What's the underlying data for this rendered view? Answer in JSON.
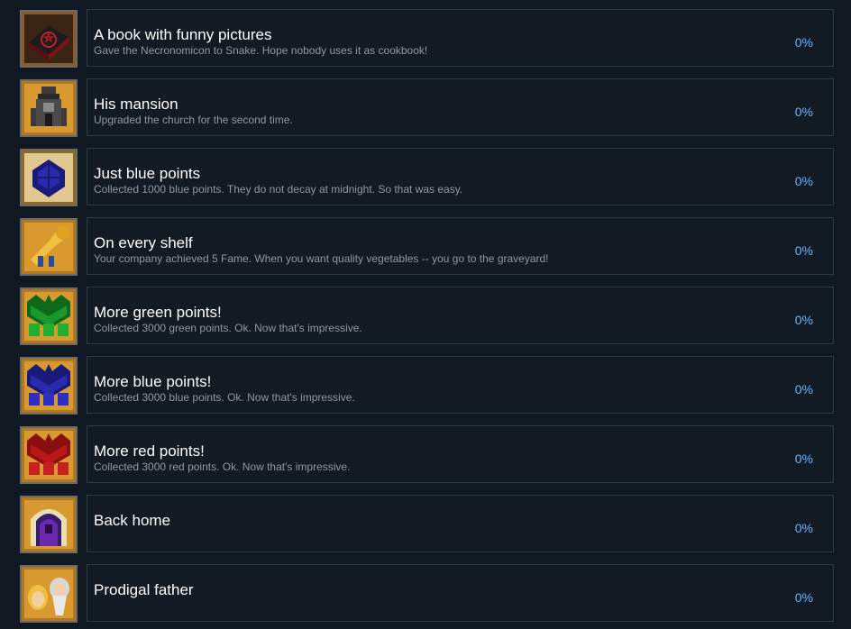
{
  "achievements": [
    {
      "title": "A book with funny pictures",
      "description": "Gave the Necronomicon to Snake. Hope nobody uses it as cookbook!",
      "percent": "0%",
      "icon": "necronomicon-book-icon"
    },
    {
      "title": "His mansion",
      "description": "Upgraded the church for the second time.",
      "percent": "0%",
      "icon": "church-mansion-icon"
    },
    {
      "title": "Just blue points",
      "description": "Collected 1000 blue points. They do not decay at midnight. So that was easy.",
      "percent": "0%",
      "icon": "blue-points-icon"
    },
    {
      "title": "On every shelf",
      "description": "Your company achieved 5 Fame. When you want quality vegetables -- you go to the graveyard!",
      "percent": "0%",
      "icon": "fame-trumpet-icon"
    },
    {
      "title": "More green points!",
      "description": "Collected 3000 green points. Ok. Now that's impressive.",
      "percent": "0%",
      "icon": "green-points-icon"
    },
    {
      "title": "More blue points!",
      "description": "Collected 3000 blue points. Ok. Now that's impressive.",
      "percent": "0%",
      "icon": "blue-points-many-icon"
    },
    {
      "title": "More red points!",
      "description": "Collected 3000 red points. Ok. Now that's impressive.",
      "percent": "0%",
      "icon": "red-points-icon"
    },
    {
      "title": "Back home",
      "description": "",
      "percent": "0%",
      "icon": "portal-door-icon"
    },
    {
      "title": "Prodigal father",
      "description": "",
      "percent": "0%",
      "icon": "father-portrait-icon"
    }
  ]
}
